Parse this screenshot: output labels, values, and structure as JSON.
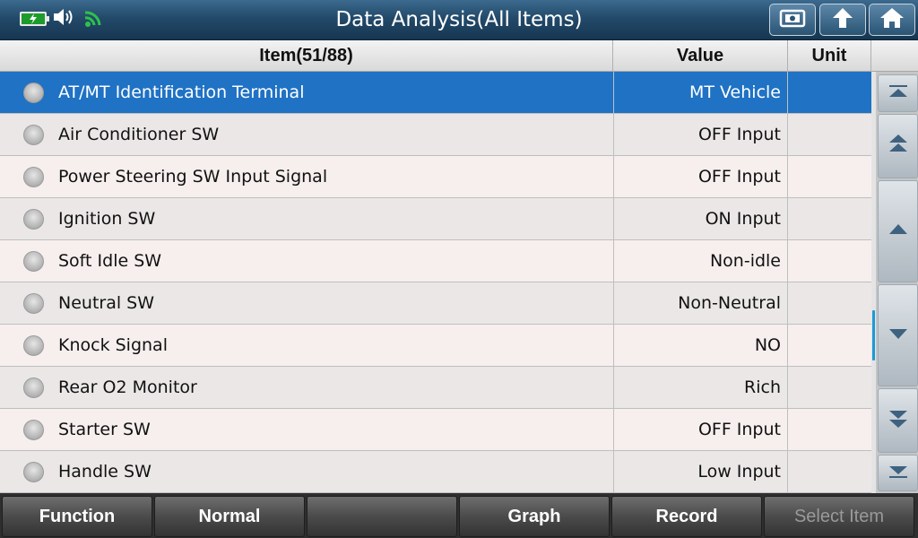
{
  "window": {
    "title": "Data Analysis(All Items)"
  },
  "top_buttons": [
    "screenshot-icon",
    "back-up-icon",
    "home-icon"
  ],
  "table": {
    "headers": {
      "item": "Item(51/88)",
      "value": "Value",
      "unit": "Unit"
    },
    "rows": [
      {
        "name": "AT/MT Identification Terminal",
        "value": "MT Vehicle",
        "unit": "",
        "selected": true
      },
      {
        "name": "Air Conditioner SW",
        "value": "OFF Input",
        "unit": ""
      },
      {
        "name": "Power Steering SW Input Signal",
        "value": "OFF Input",
        "unit": ""
      },
      {
        "name": "Ignition SW",
        "value": "ON Input",
        "unit": ""
      },
      {
        "name": "Soft Idle SW",
        "value": "Non-idle",
        "unit": ""
      },
      {
        "name": "Neutral SW",
        "value": "Non-Neutral",
        "unit": ""
      },
      {
        "name": "Knock Signal",
        "value": "NO",
        "unit": ""
      },
      {
        "name": "Rear O2 Monitor",
        "value": "Rich",
        "unit": ""
      },
      {
        "name": "Starter SW",
        "value": "OFF Input",
        "unit": ""
      },
      {
        "name": "Handle SW",
        "value": "Low Input",
        "unit": ""
      }
    ]
  },
  "scroll_buttons": [
    "scroll-top-icon",
    "page-up-icon",
    "line-up-icon",
    "line-down-icon",
    "page-down-icon",
    "scroll-bottom-icon"
  ],
  "bottom_bar": {
    "buttons": [
      "Function",
      "Normal",
      "",
      "Graph",
      "Record",
      "Select Item"
    ]
  },
  "colors": {
    "selected_row": "#1f72c4",
    "scroll_thumb": "#1a9ad7",
    "title_bar": "#234a6a"
  }
}
